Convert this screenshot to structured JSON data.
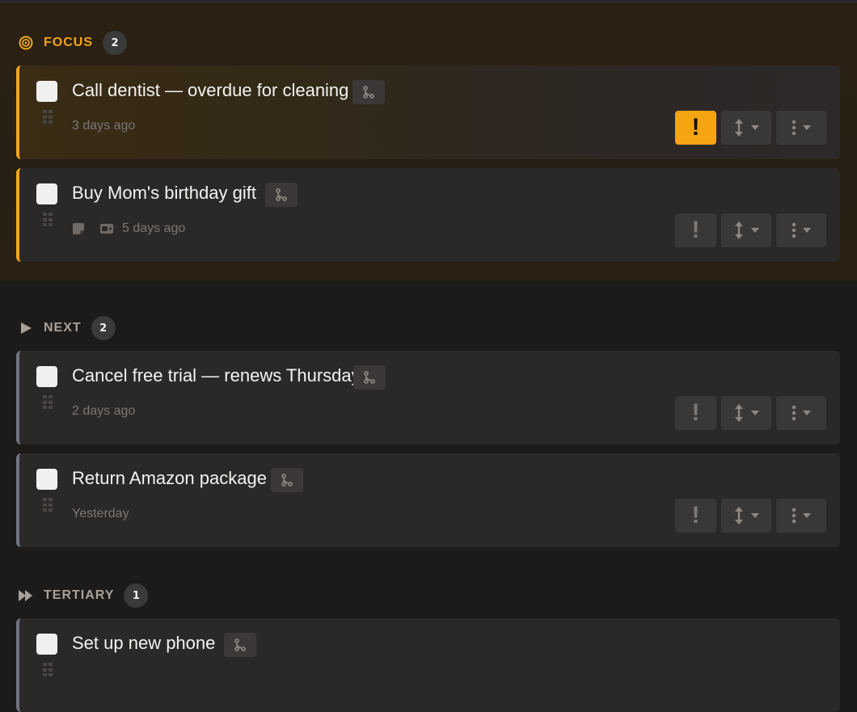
{
  "sections": [
    {
      "id": "focus",
      "title": "FOCUS",
      "count": "2",
      "icon": "target-icon",
      "color": "#f0a51a",
      "tasks": [
        {
          "title": "Call dentist — overdue for cleaning",
          "age": "3 days ago",
          "priority_active": true,
          "meta_icons": []
        },
        {
          "title": "Buy Mom's birthday gift",
          "age": "5 days ago",
          "priority_active": false,
          "meta_icons": [
            "note-icon",
            "link-icon"
          ]
        }
      ]
    },
    {
      "id": "next",
      "title": "NEXT",
      "count": "2",
      "icon": "play-icon",
      "color": "#a8a19b",
      "tasks": [
        {
          "title": "Cancel free trial — renews Thursday",
          "age": "2 days ago",
          "priority_active": false,
          "meta_icons": []
        },
        {
          "title": "Return Amazon package",
          "age": "Yesterday",
          "priority_active": false,
          "meta_icons": []
        }
      ]
    },
    {
      "id": "tertiary",
      "title": "TERTIARY",
      "count": "1",
      "icon": "fast-forward-icon",
      "color": "#a8a19b",
      "tasks": [
        {
          "title": "Set up new phone",
          "age": "",
          "priority_active": false,
          "meta_icons": []
        }
      ]
    }
  ],
  "buttons": {
    "priority_label": "!"
  },
  "colors": {
    "accent": "#f0a51a",
    "next_border": "#6d7580",
    "background": "#1d1b1a",
    "card": "#2b2928"
  }
}
